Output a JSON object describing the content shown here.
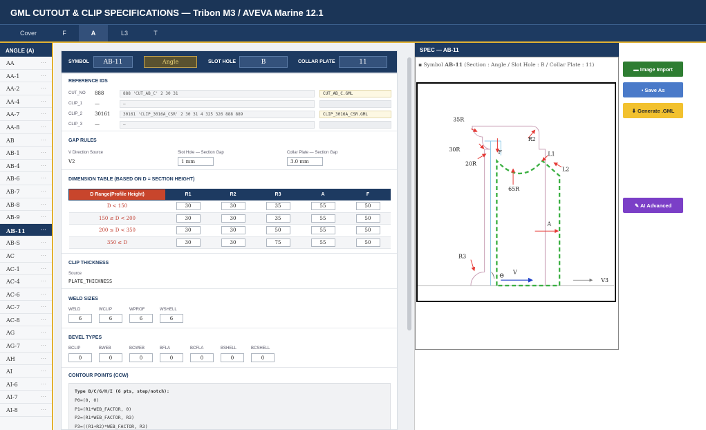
{
  "title": "GML CUTOUT & CLIP SPECIFICATIONS — Tribon M3 / AVEVA Marine 12.1",
  "tabs": [
    {
      "label": "Cover"
    },
    {
      "label": "F"
    },
    {
      "label": "A",
      "active": true
    },
    {
      "label": "L3"
    },
    {
      "label": "T"
    }
  ],
  "sidebar": {
    "header": "ANGLE (A)",
    "items": [
      {
        "label": "AA"
      },
      {
        "label": "AA-1"
      },
      {
        "label": "AA-2"
      },
      {
        "label": "AA-4"
      },
      {
        "label": "AA-7"
      },
      {
        "label": "AA-8"
      },
      {
        "label": "AB"
      },
      {
        "label": "AB-1"
      },
      {
        "label": "AB-4"
      },
      {
        "label": "AB-6"
      },
      {
        "label": "AB-7"
      },
      {
        "label": "AB-8"
      },
      {
        "label": "AB-9"
      },
      {
        "label": "AB-11",
        "selected": true
      },
      {
        "label": "AB-S"
      },
      {
        "label": "AC"
      },
      {
        "label": "AC-1"
      },
      {
        "label": "AC-4"
      },
      {
        "label": "AC-6"
      },
      {
        "label": "AC-7"
      },
      {
        "label": "AC-8"
      },
      {
        "label": "AG"
      },
      {
        "label": "AG-7"
      },
      {
        "label": "AH"
      },
      {
        "label": "AI"
      },
      {
        "label": "AI-6"
      },
      {
        "label": "AI-7"
      },
      {
        "label": "AI-8"
      }
    ],
    "dots": "···"
  },
  "symbol_bar": {
    "symbol_label": "SYMBOL",
    "symbol_value": "AB-11",
    "section_value": "Angle",
    "slot_label": "SLOT HOLE",
    "slot_value": "B",
    "collar_label": "COLLAR PLATE",
    "collar_value": "11"
  },
  "reference_ids": {
    "title": "REFERENCE IDS",
    "rows": [
      {
        "label": "CUT_NO",
        "num": "888",
        "ref": "888 'CUT_AB_C' 2 30 31",
        "gml": "CUT_AB_C.GML"
      },
      {
        "label": "CLIP_1",
        "num": "—",
        "ref": "—",
        "gml": ""
      },
      {
        "label": "CLIP_2",
        "num": "30161",
        "ref": "30161 'CLIP_3016A_CSR' 2 30 31 4 325 326 888 889",
        "gml": "CLIP_3016A_CSR.GML"
      },
      {
        "label": "CLIP_3",
        "num": "—",
        "ref": "—",
        "gml": ""
      }
    ]
  },
  "gap_rules": {
    "title": "GAP RULES",
    "v_label": "V Direction Source",
    "v_value": "V2",
    "slot_label": "Slot Hole — Section Gap",
    "slot_value": "1 mm",
    "collar_label": "Collar Plate — Section Gap",
    "collar_value": "3.0 mm"
  },
  "dimension_table": {
    "title": "DIMENSION TABLE (BASED ON D = SECTION HEIGHT)",
    "headers": [
      "D Range(Profile Height)",
      "R1",
      "R2",
      "R3",
      "A",
      "F"
    ],
    "rows": [
      {
        "range": "D < 150",
        "r1": "30",
        "r2": "30",
        "r3": "35",
        "a": "55",
        "f": "50"
      },
      {
        "range": "150 ≤ D < 200",
        "r1": "30",
        "r2": "30",
        "r3": "35",
        "a": "55",
        "f": "50"
      },
      {
        "range": "200 ≤ D < 350",
        "r1": "30",
        "r2": "30",
        "r3": "50",
        "a": "55",
        "f": "50"
      },
      {
        "range": "350 ≤ D",
        "r1": "30",
        "r2": "30",
        "r3": "75",
        "a": "55",
        "f": "50"
      }
    ]
  },
  "clip_thickness": {
    "title": "CLIP THICKNESS",
    "source_label": "Source",
    "source_value": "PLATE_THICKNESS"
  },
  "weld_sizes": {
    "title": "WELD SIZES",
    "items": [
      {
        "label": "WELD",
        "value": "6"
      },
      {
        "label": "WCLIP",
        "value": "6"
      },
      {
        "label": "WPROF",
        "value": "6"
      },
      {
        "label": "WSHELL",
        "value": "6"
      }
    ]
  },
  "bevel_types": {
    "title": "BEVEL TYPES",
    "items": [
      {
        "label": "BCLIP",
        "value": "0"
      },
      {
        "label": "BWEB",
        "value": "0"
      },
      {
        "label": "BCWEB",
        "value": "0"
      },
      {
        "label": "BFLA",
        "value": "0"
      },
      {
        "label": "BCFLA",
        "value": "0"
      },
      {
        "label": "BSHELL",
        "value": "0"
      },
      {
        "label": "BCSHELL",
        "value": "0"
      }
    ]
  },
  "contour": {
    "title": "CONTOUR POINTS (CCW)",
    "lines": [
      "Type B/C/G/H/I (6 pts, step/notch):",
      "P0=(0, 0)",
      "P1=(R1*WEB_FACTOR, 0)",
      "P2=(R1*WEB_FACTOR, R3)",
      "P3=((R1+R2)*WEB_FACTOR, R3)"
    ]
  },
  "spec": {
    "header": "SPEC — AB-11",
    "caption_pre": "▪ Symbol ",
    "caption_symbol": "AB-11",
    "caption_rest": " (Section : Angle / Slot Hole : B / Collar Plate : 11)",
    "labels": {
      "r35": "35R",
      "r30": "30R",
      "r20": "20R",
      "r2": "R2",
      "f": "F",
      "l1": "L1",
      "l2": "L2",
      "r65": "65R",
      "a": "A",
      "r3": "R3",
      "theta": "Θ",
      "v": "V",
      "v3": "V3"
    }
  },
  "buttons": {
    "image_import": "Image Import",
    "image_import_icon": "▬",
    "save_as": "Save As",
    "save_as_icon": "▪",
    "generate": "Generate .GML",
    "generate_icon": "⬇",
    "ai_advanced": "AI Advanced",
    "ai_advanced_icon": "✎"
  },
  "colors": {
    "navy": "#1d3a61",
    "accent": "#e2b232",
    "green": "#2e7d32",
    "blue": "#4a7ac9",
    "yellow": "#f2c12e",
    "purple": "#7b3fc7",
    "red": "#c8452c"
  }
}
